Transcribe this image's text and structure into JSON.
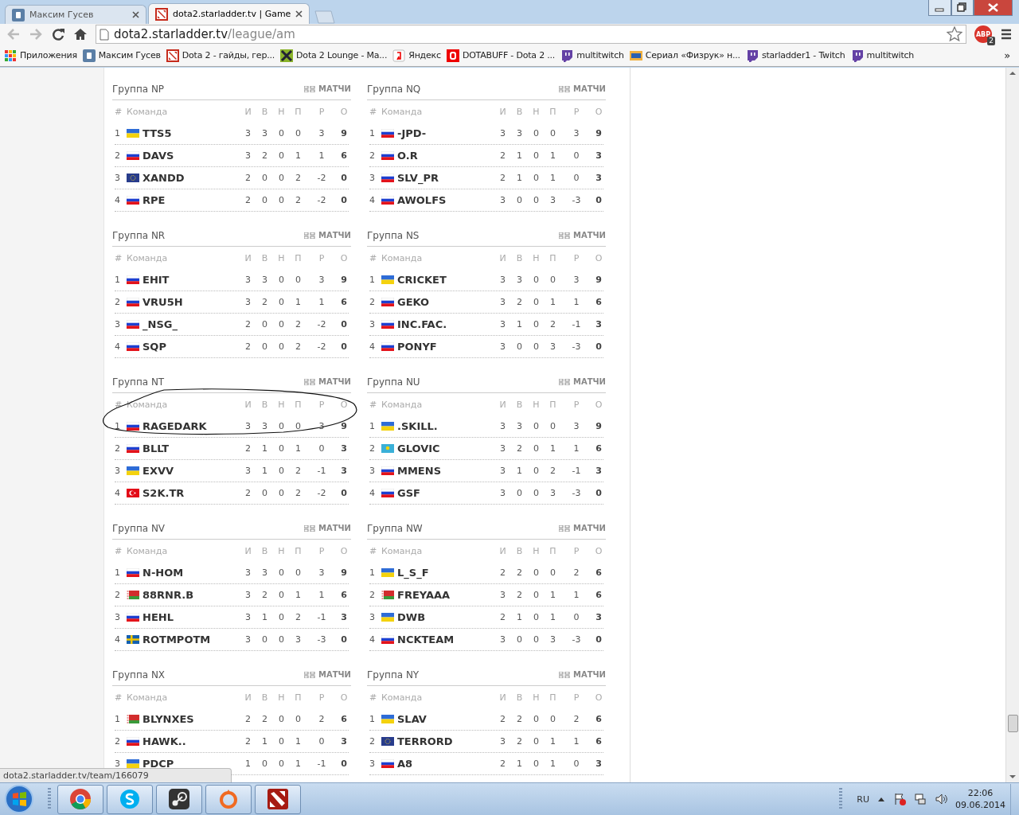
{
  "browser": {
    "tabs": [
      {
        "title": "Максим Гусев",
        "kind": "vk",
        "selected": false
      },
      {
        "title": "dota2.starladder.tv | Game",
        "kind": "dota",
        "selected": true
      }
    ],
    "address": {
      "host": "dota2.starladder.tv",
      "path": "/league/am"
    },
    "abp": {
      "label": "ABP",
      "badge": "2"
    },
    "bookmarks": [
      {
        "label": "Приложения",
        "kind": "apps"
      },
      {
        "label": "Максим Гусев",
        "kind": "vk"
      },
      {
        "label": "Dota 2 - гайды, гер...",
        "kind": "dota"
      },
      {
        "label": "Dota 2 Lounge - Ma...",
        "kind": "lounge"
      },
      {
        "label": "Яндекс",
        "kind": "yandex"
      },
      {
        "label": "DOTABUFF - Dota 2 ...",
        "kind": "dotabuff"
      },
      {
        "label": "multitwitch",
        "kind": "twitch"
      },
      {
        "label": "Сериал «Физрук» н...",
        "kind": "tv"
      },
      {
        "label": "starladder1 - Twitch",
        "kind": "twitch"
      },
      {
        "label": "multitwitch",
        "kind": "twitch"
      }
    ],
    "bookmarks_more": "»"
  },
  "groups": [
    {
      "title": "Группа NP",
      "matches": "МАТЧИ",
      "columns": [
        "#",
        "Команда",
        "И",
        "В",
        "Н",
        "П",
        "Р",
        "О"
      ],
      "rows": [
        {
          "rank": "1",
          "flag": {
            "kind": "ua"
          },
          "team": "TTS5",
          "stats": [
            "3",
            "3",
            "0",
            "0",
            "3",
            "9"
          ],
          "circled": false
        },
        {
          "rank": "2",
          "flag": {
            "kind": "ru"
          },
          "team": "DAVS",
          "stats": [
            "3",
            "2",
            "0",
            "1",
            "1",
            "6"
          ],
          "circled": false
        },
        {
          "rank": "3",
          "flag": {
            "kind": "eu"
          },
          "team": "XANDD",
          "stats": [
            "2",
            "0",
            "0",
            "2",
            "-2",
            "0"
          ],
          "circled": false
        },
        {
          "rank": "4",
          "flag": {
            "kind": "ru"
          },
          "team": "RPE",
          "stats": [
            "2",
            "0",
            "0",
            "2",
            "-2",
            "0"
          ],
          "circled": false
        }
      ]
    },
    {
      "title": "Группа NQ",
      "matches": "МАТЧИ",
      "columns": [
        "#",
        "Команда",
        "И",
        "В",
        "Н",
        "П",
        "Р",
        "О"
      ],
      "rows": [
        {
          "rank": "1",
          "flag": {
            "kind": "ru"
          },
          "team": "-JPD-",
          "stats": [
            "3",
            "3",
            "0",
            "0",
            "3",
            "9"
          ],
          "circled": false
        },
        {
          "rank": "2",
          "flag": {
            "kind": "ru"
          },
          "team": "O.R",
          "stats": [
            "2",
            "1",
            "0",
            "1",
            "0",
            "3"
          ],
          "circled": false
        },
        {
          "rank": "3",
          "flag": {
            "kind": "ru"
          },
          "team": "SLV_PR",
          "stats": [
            "2",
            "1",
            "0",
            "1",
            "0",
            "3"
          ],
          "circled": false
        },
        {
          "rank": "4",
          "flag": {
            "kind": "ru"
          },
          "team": "AWOLFS",
          "stats": [
            "3",
            "0",
            "0",
            "3",
            "-3",
            "0"
          ],
          "circled": false
        }
      ]
    },
    {
      "title": "Группа NR",
      "matches": "МАТЧИ",
      "columns": [
        "#",
        "Команда",
        "И",
        "В",
        "Н",
        "П",
        "Р",
        "О"
      ],
      "rows": [
        {
          "rank": "1",
          "flag": {
            "kind": "ru"
          },
          "team": "EHIT",
          "stats": [
            "3",
            "3",
            "0",
            "0",
            "3",
            "9"
          ],
          "circled": false
        },
        {
          "rank": "2",
          "flag": {
            "kind": "ru"
          },
          "team": "VRU5H",
          "stats": [
            "3",
            "2",
            "0",
            "1",
            "1",
            "6"
          ],
          "circled": false
        },
        {
          "rank": "3",
          "flag": {
            "kind": "ru"
          },
          "team": "_NSG_",
          "stats": [
            "2",
            "0",
            "0",
            "2",
            "-2",
            "0"
          ],
          "circled": false
        },
        {
          "rank": "4",
          "flag": {
            "kind": "ru"
          },
          "team": "SQP",
          "stats": [
            "2",
            "0",
            "0",
            "2",
            "-2",
            "0"
          ],
          "circled": false
        }
      ]
    },
    {
      "title": "Группа NS",
      "matches": "МАТЧИ",
      "columns": [
        "#",
        "Команда",
        "И",
        "В",
        "Н",
        "П",
        "Р",
        "О"
      ],
      "rows": [
        {
          "rank": "1",
          "flag": {
            "kind": "ua"
          },
          "team": "CRICKET",
          "stats": [
            "3",
            "3",
            "0",
            "0",
            "3",
            "9"
          ],
          "circled": false
        },
        {
          "rank": "2",
          "flag": {
            "kind": "ru"
          },
          "team": "GEKO",
          "stats": [
            "3",
            "2",
            "0",
            "1",
            "1",
            "6"
          ],
          "circled": false
        },
        {
          "rank": "3",
          "flag": {
            "kind": "ru"
          },
          "team": "INC.FAC.",
          "stats": [
            "3",
            "1",
            "0",
            "2",
            "-1",
            "3"
          ],
          "circled": false
        },
        {
          "rank": "4",
          "flag": {
            "kind": "ru"
          },
          "team": "PONYF",
          "stats": [
            "3",
            "0",
            "0",
            "3",
            "-3",
            "0"
          ],
          "circled": false
        }
      ]
    },
    {
      "title": "Группа NT",
      "matches": "МАТЧИ",
      "columns": [
        "#",
        "Команда",
        "И",
        "В",
        "Н",
        "П",
        "Р",
        "О"
      ],
      "rows": [
        {
          "rank": "1",
          "flag": {
            "kind": "ru"
          },
          "team": "RAGEDARK",
          "stats": [
            "3",
            "3",
            "0",
            "0",
            "3",
            "9"
          ],
          "circled": true
        },
        {
          "rank": "2",
          "flag": {
            "kind": "ru"
          },
          "team": "BLLT",
          "stats": [
            "2",
            "1",
            "0",
            "1",
            "0",
            "3"
          ],
          "circled": false
        },
        {
          "rank": "3",
          "flag": {
            "kind": "ua"
          },
          "team": "EXVV",
          "stats": [
            "3",
            "1",
            "0",
            "2",
            "-1",
            "3"
          ],
          "circled": false
        },
        {
          "rank": "4",
          "flag": {
            "kind": "tr"
          },
          "team": "S2K.TR",
          "stats": [
            "2",
            "0",
            "0",
            "2",
            "-2",
            "0"
          ],
          "circled": false
        }
      ]
    },
    {
      "title": "Группа NU",
      "matches": "МАТЧИ",
      "columns": [
        "#",
        "Команда",
        "И",
        "В",
        "Н",
        "П",
        "Р",
        "О"
      ],
      "rows": [
        {
          "rank": "1",
          "flag": {
            "kind": "ua"
          },
          "team": ".SKILL.",
          "stats": [
            "3",
            "3",
            "0",
            "0",
            "3",
            "9"
          ],
          "circled": false
        },
        {
          "rank": "2",
          "flag": {
            "kind": "kz"
          },
          "team": "GLOVIC",
          "stats": [
            "3",
            "2",
            "0",
            "1",
            "1",
            "6"
          ],
          "circled": false
        },
        {
          "rank": "3",
          "flag": {
            "kind": "ru"
          },
          "team": "MMENS",
          "stats": [
            "3",
            "1",
            "0",
            "2",
            "-1",
            "3"
          ],
          "circled": false
        },
        {
          "rank": "4",
          "flag": {
            "kind": "ru"
          },
          "team": "GSF",
          "stats": [
            "3",
            "0",
            "0",
            "3",
            "-3",
            "0"
          ],
          "circled": false
        }
      ]
    },
    {
      "title": "Группа NV",
      "matches": "МАТЧИ",
      "columns": [
        "#",
        "Команда",
        "И",
        "В",
        "Н",
        "П",
        "Р",
        "О"
      ],
      "rows": [
        {
          "rank": "1",
          "flag": {
            "kind": "ru"
          },
          "team": "N-HOM",
          "stats": [
            "3",
            "3",
            "0",
            "0",
            "3",
            "9"
          ],
          "circled": false
        },
        {
          "rank": "2",
          "flag": {
            "kind": "by"
          },
          "team": "88RNR.B",
          "stats": [
            "3",
            "2",
            "0",
            "1",
            "1",
            "6"
          ],
          "circled": false
        },
        {
          "rank": "3",
          "flag": {
            "kind": "ru"
          },
          "team": "HEHL",
          "stats": [
            "3",
            "1",
            "0",
            "2",
            "-1",
            "3"
          ],
          "circled": false
        },
        {
          "rank": "4",
          "flag": {
            "kind": "se"
          },
          "team": "ROTMPOTM",
          "stats": [
            "3",
            "0",
            "0",
            "3",
            "-3",
            "0"
          ],
          "circled": false
        }
      ]
    },
    {
      "title": "Группа NW",
      "matches": "МАТЧИ",
      "columns": [
        "#",
        "Команда",
        "И",
        "В",
        "Н",
        "П",
        "Р",
        "О"
      ],
      "rows": [
        {
          "rank": "1",
          "flag": {
            "kind": "ua"
          },
          "team": "L_S_F",
          "stats": [
            "2",
            "2",
            "0",
            "0",
            "2",
            "6"
          ],
          "circled": false
        },
        {
          "rank": "2",
          "flag": {
            "kind": "by"
          },
          "team": "FREYAAA",
          "stats": [
            "3",
            "2",
            "0",
            "1",
            "1",
            "6"
          ],
          "circled": false
        },
        {
          "rank": "3",
          "flag": {
            "kind": "ua"
          },
          "team": "DWB",
          "stats": [
            "2",
            "1",
            "0",
            "1",
            "0",
            "3"
          ],
          "circled": false
        },
        {
          "rank": "4",
          "flag": {
            "kind": "ru"
          },
          "team": "NCKTEAM",
          "stats": [
            "3",
            "0",
            "0",
            "3",
            "-3",
            "0"
          ],
          "circled": false
        }
      ]
    },
    {
      "title": "Группа NX",
      "matches": "МАТЧИ",
      "columns": [
        "#",
        "Команда",
        "И",
        "В",
        "Н",
        "П",
        "Р",
        "О"
      ],
      "rows": [
        {
          "rank": "1",
          "flag": {
            "kind": "by"
          },
          "team": "BLYNXES",
          "stats": [
            "2",
            "2",
            "0",
            "0",
            "2",
            "6"
          ],
          "circled": false
        },
        {
          "rank": "2",
          "flag": {
            "kind": "ru"
          },
          "team": "HAWK..",
          "stats": [
            "2",
            "1",
            "0",
            "1",
            "0",
            "3"
          ],
          "circled": false
        },
        {
          "rank": "3",
          "flag": {
            "kind": "ua"
          },
          "team": "PDCP",
          "stats": [
            "1",
            "0",
            "0",
            "1",
            "-1",
            "0"
          ],
          "circled": false
        }
      ]
    },
    {
      "title": "Группа NY",
      "matches": "МАТЧИ",
      "columns": [
        "#",
        "Команда",
        "И",
        "В",
        "Н",
        "П",
        "Р",
        "О"
      ],
      "rows": [
        {
          "rank": "1",
          "flag": {
            "kind": "ua"
          },
          "team": "SLAV",
          "stats": [
            "2",
            "2",
            "0",
            "0",
            "2",
            "6"
          ],
          "circled": false
        },
        {
          "rank": "2",
          "flag": {
            "kind": "eu"
          },
          "team": "TERRORD",
          "stats": [
            "3",
            "2",
            "0",
            "1",
            "1",
            "6"
          ],
          "circled": false
        },
        {
          "rank": "3",
          "flag": {
            "kind": "ru"
          },
          "team": "A8",
          "stats": [
            "2",
            "1",
            "0",
            "1",
            "0",
            "3"
          ],
          "circled": false
        }
      ]
    }
  ],
  "status_url": "dota2.starladder.tv/team/166079",
  "taskbar": {
    "apps": [
      {
        "kind": "chrome"
      },
      {
        "kind": "skype"
      },
      {
        "kind": "steam"
      },
      {
        "kind": "origin"
      },
      {
        "kind": "dota"
      }
    ],
    "language": "RU",
    "time": "22:06",
    "date": "09.06.2014"
  }
}
